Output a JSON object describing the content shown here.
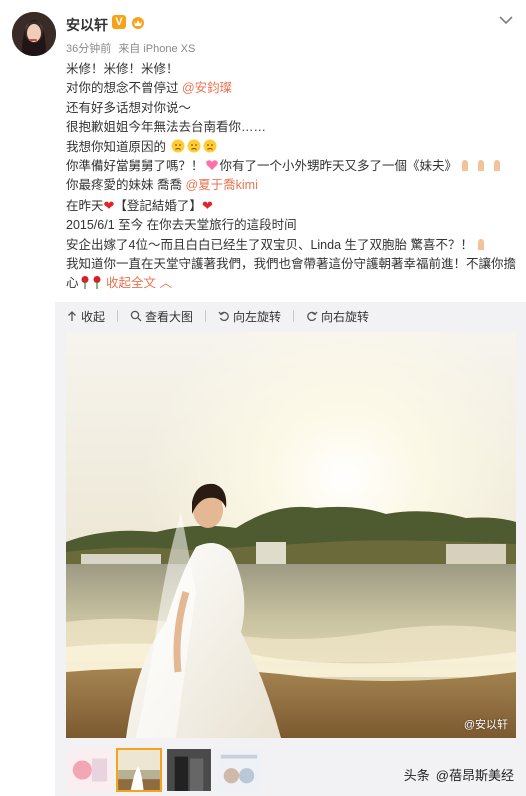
{
  "user": {
    "name": "安以轩",
    "verified_badge": "V",
    "meta_time": "36分钟前",
    "meta_source": "来自 iPhone XS"
  },
  "post": {
    "line1": "米修！米修！米修！",
    "line2": "对你的想念不曾停过 ",
    "mention1": "@安鈞璨",
    "line3": "还有好多话想对你说～",
    "line4": "很抱歉姐姐今年無法去台南看你……",
    "line5": "我想你知道原因的",
    "line6a": "你準備好當舅舅了嗎？！",
    "line6b": "你有了一个小外甥昨天又多了一個《妹夫》",
    "line7a": "你最疼愛的妹妹 喬喬 ",
    "mention2": "@夏于喬kimi",
    "line8a": "在昨天",
    "line8b": "【登記結婚了】",
    "line9": "2015/6/1 至今 在你去天堂旅行的這段时间",
    "line10a": "安企出嫁了4位～而且白白已经生了双宝贝、Linda 生了双胞胎 驚喜不？！",
    "line11": "我知道你一直在天堂守護著我們，我們也會帶著這份守護朝著幸福前進！不讓你擔心",
    "collapse_label": "收起全文",
    "collapse_arrow": "^"
  },
  "toolbar": {
    "collapse": "收起",
    "view_large": "查看大图",
    "rotate_left": "向左旋转",
    "rotate_right": "向右旋转"
  },
  "photo": {
    "watermark": "@安以轩"
  },
  "source": {
    "platform": "头条",
    "author": "@蓓昂斯美经"
  },
  "colors": {
    "link": "#eb7350",
    "badge": "#f7a21a",
    "heart": "#e0242a"
  }
}
